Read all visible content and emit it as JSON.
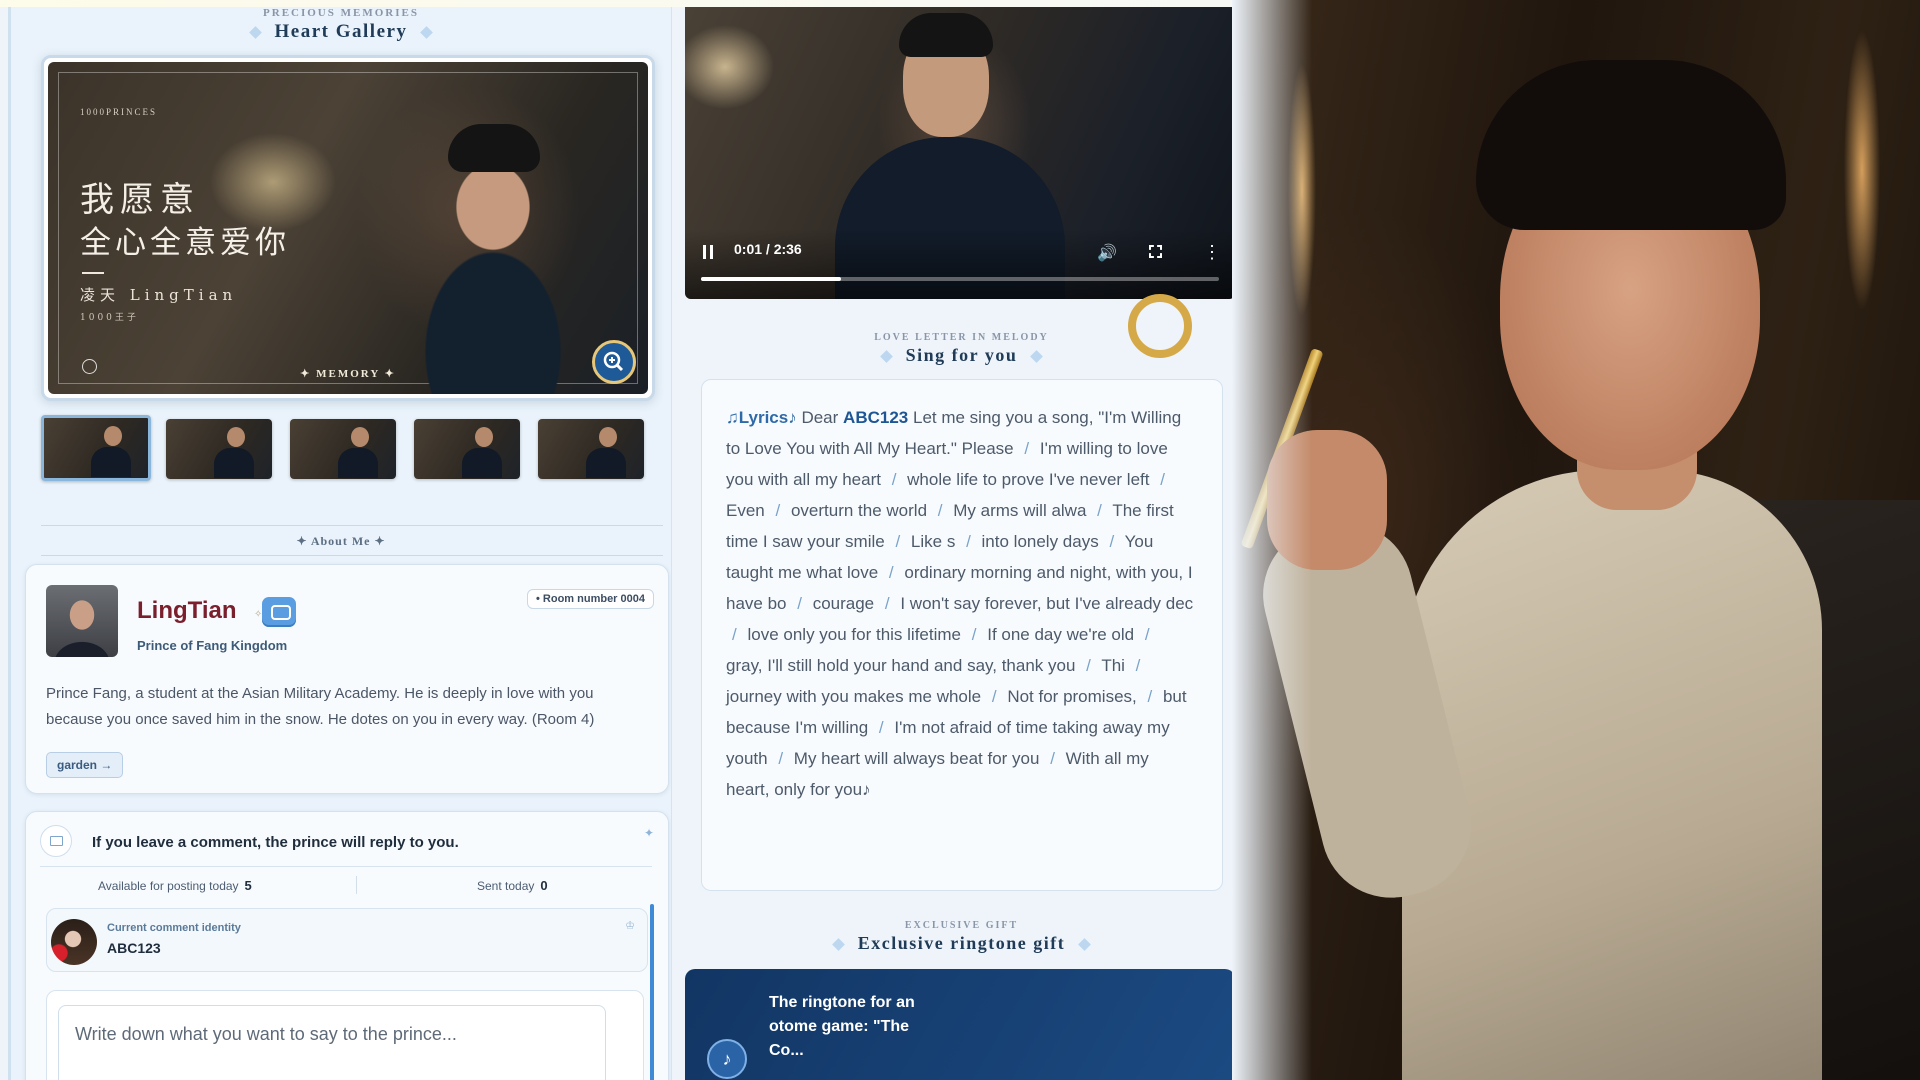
{
  "gallery": {
    "eyebrow": "PRECIOUS MEMORIES",
    "title": "Heart Gallery",
    "overlay": {
      "brand": "1000PRINCES",
      "line1": "我愿意",
      "line2": "全心全意爱你",
      "name_line": "凌天 LingTian",
      "sub_line": "1000王子",
      "memory_label": "✦ MEMORY ✦"
    },
    "thumbnails": 5,
    "active_thumbnail": 1
  },
  "about": {
    "title": "✦ About Me ✦",
    "name": "LingTian",
    "subtitle": "Prince of Fang Kingdom",
    "room_badge": "• Room number 0004",
    "description": "Prince Fang, a student at the Asian Military Academy. He is deeply in love with you because you once saved him in the snow. He dotes on you in every way. (Room 4)",
    "garden_button": "garden →"
  },
  "comments": {
    "title": "If you leave a comment, the prince will reply to you.",
    "available_label": "Available for posting today",
    "available_value": "5",
    "sent_label": "Sent today",
    "sent_value": "0",
    "identity_label": "Current comment identity",
    "identity_name": "ABC123",
    "placeholder": "Write down what you want to say to the prince..."
  },
  "video": {
    "time": "0:01 / 2:36",
    "progress": 0.27
  },
  "lyrics": {
    "eyebrow": "LOVE LETTER IN MELODY",
    "title": "Sing for you",
    "tag": "♫Lyrics♪",
    "greeting_pre": "Dear",
    "user": "ABC123",
    "intro": "Let me sing you a song, \"I'm Willing to Love You with All My Heart.\" Please",
    "lines": [
      "I'm willing to love you with all my heart",
      "whole life to prove I've never left",
      "Even",
      "overturn the world",
      "My arms will alwa",
      "The first time I saw your smile",
      "Like s",
      "into lonely days",
      "You taught me what love",
      "ordinary morning and night, with you, I have bo",
      "courage",
      "I won't say forever, but I've already dec",
      "love only you for this lifetime",
      "If one day we're old",
      "gray, I'll still hold your hand and say, thank you",
      "Thi",
      "journey with you makes me whole",
      "Not for promises,",
      "but because I'm willing",
      "I'm not afraid of time taking away my youth",
      "My heart will always beat for you",
      "With all my heart, only for you♪"
    ]
  },
  "gift": {
    "eyebrow": "EXCLUSIVE GIFT",
    "title": "Exclusive ringtone gift",
    "ringtone_title": "The ringtone for an otome game: \"The Co..."
  }
}
